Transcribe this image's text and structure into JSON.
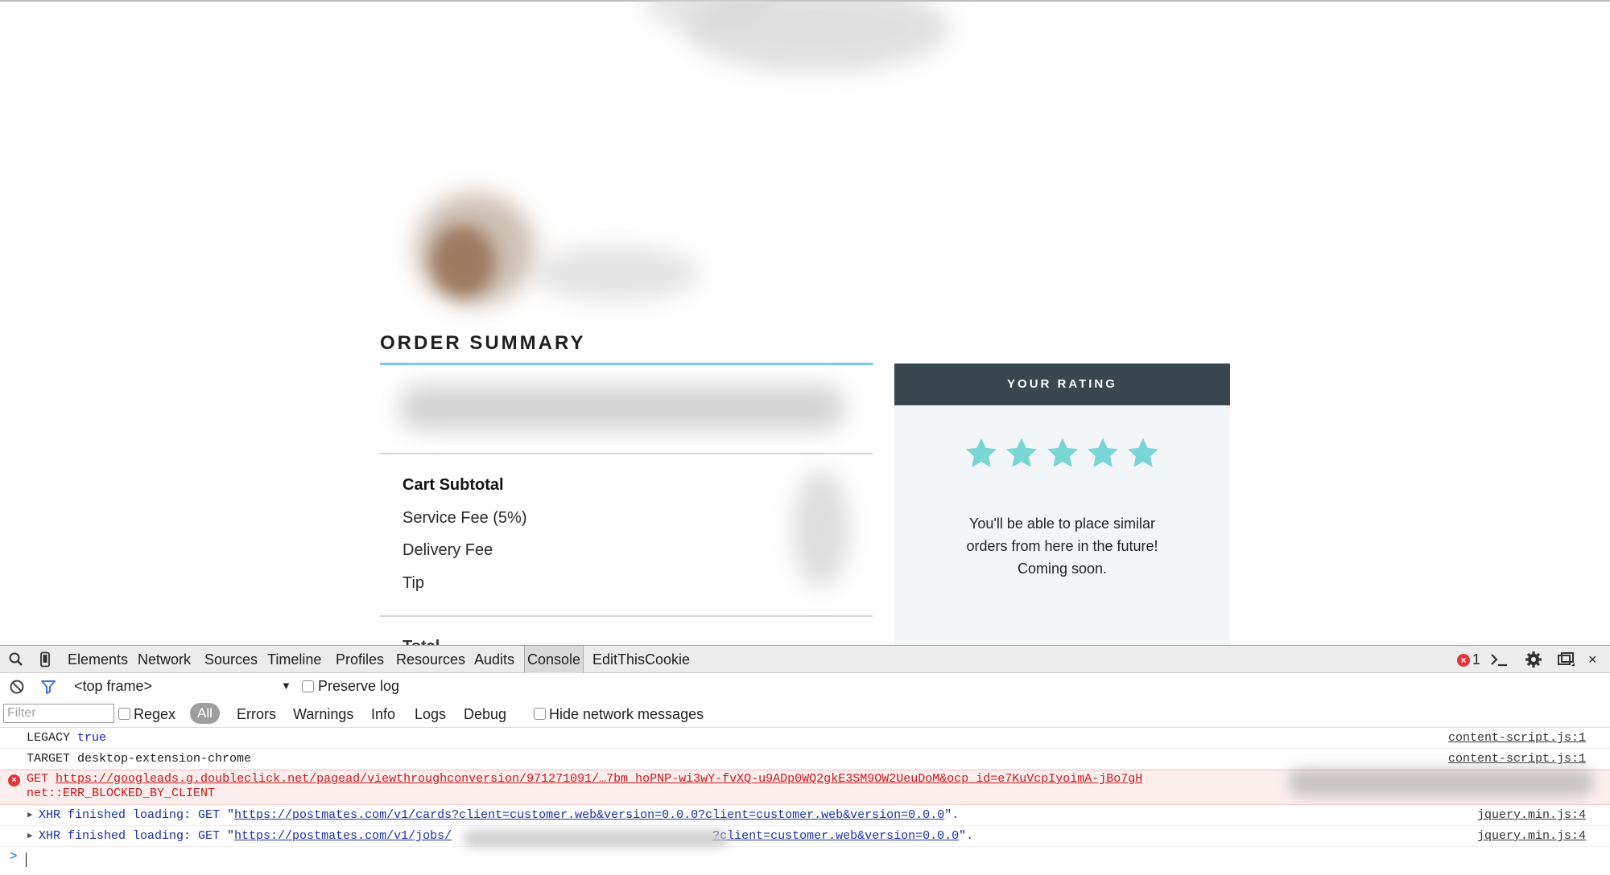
{
  "page": {
    "order_summary_title": "ORDER SUMMARY",
    "fees": [
      "Cart Subtotal",
      "Service Fee (5%)",
      "Delivery Fee",
      "Tip"
    ],
    "total_label_peek": "Total",
    "rating": {
      "header": "YOUR RATING",
      "stars_filled": 5,
      "stars_total": 5,
      "star_color": "#7ad6d6",
      "message_lines": [
        "You'll be able to place similar",
        "orders from here in the future!",
        "Coming soon."
      ]
    },
    "accent_color": "#72d2d4"
  },
  "devtools": {
    "tabs": [
      "Elements",
      "Network",
      "Sources",
      "Timeline",
      "Profiles",
      "Resources",
      "Audits",
      "Console",
      "EditThisCookie"
    ],
    "active_tab": "Console",
    "error_count": "1",
    "frame_selector": "<top frame>",
    "preserve_log_label": "Preserve log",
    "filter_placeholder": "Filter",
    "regex_label": "Regex",
    "levels": [
      "All",
      "Errors",
      "Warnings",
      "Info",
      "Logs",
      "Debug"
    ],
    "hide_network_label": "Hide network messages",
    "messages": [
      {
        "type": "log",
        "key": "LEGACY",
        "value": "true",
        "source": "content-script.js:1"
      },
      {
        "type": "log",
        "text": "TARGET desktop-extension-chrome",
        "source": "content-script.js:1"
      },
      {
        "type": "error",
        "method": "GET",
        "url": "https://googleads.g.doubleclick.net/pagead/viewthroughconversion/971271091/…7bm_hoPNP-wi3wY-fvXQ-u9ADp0WQ2gkE3SM9OW2UeuDoM&ocp_id=e7KuVcpIyoimA-jBo7gH",
        "detail": "net::ERR_BLOCKED_BY_CLIENT"
      },
      {
        "type": "xhr",
        "prefix": "XHR finished loading: GET \"",
        "url": "https://postmates.com/v1/cards?client=customer.web&version=0.0.0?client=customer.web&version=0.0.0",
        "suffix": "\".",
        "source": "jquery.min.js:4"
      },
      {
        "type": "xhr",
        "prefix": "XHR finished loading: GET \"",
        "url_start": "https://postmates.com/v1/jobs/",
        "url_end": "?client=customer.web&version=0.0.0",
        "suffix": "\".",
        "source": "jquery.min.js:4"
      }
    ],
    "prompt_symbol": ">"
  }
}
